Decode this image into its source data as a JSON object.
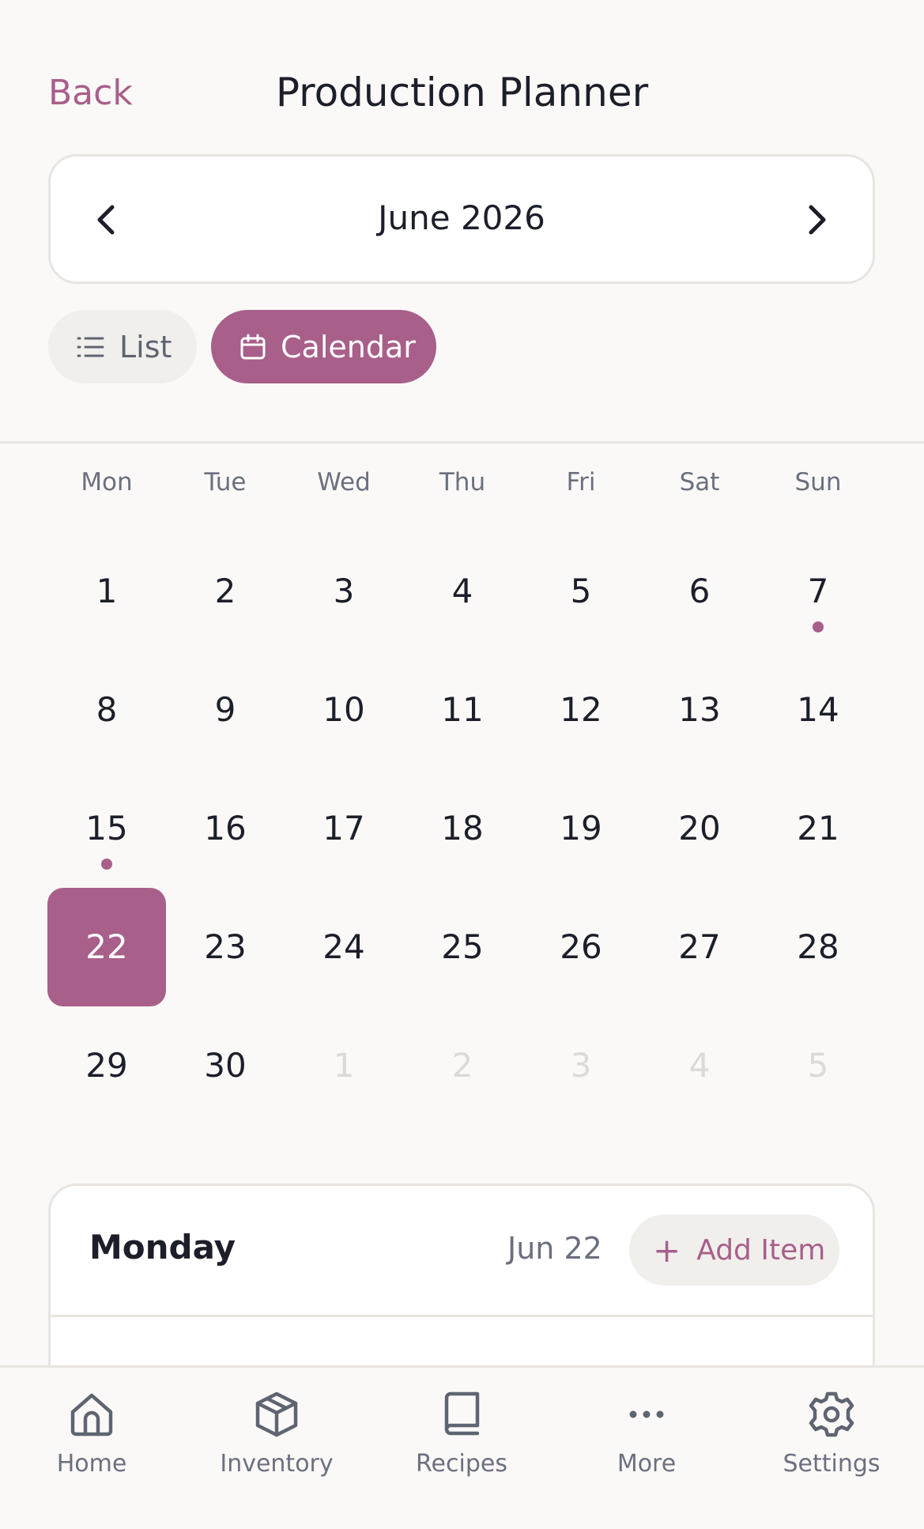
{
  "header": {
    "back_label": "Back",
    "title": "Production Planner"
  },
  "month_nav": {
    "label": "June 2026",
    "prev_icon": "chevron-left-icon",
    "next_icon": "chevron-right-icon"
  },
  "view_toggle": {
    "list_label": "List",
    "calendar_label": "Calendar",
    "selected": "Calendar"
  },
  "calendar": {
    "weekdays": [
      "Mon",
      "Tue",
      "Wed",
      "Thu",
      "Fri",
      "Sat",
      "Sun"
    ],
    "weeks": [
      [
        "1",
        "2",
        "3",
        "4",
        "5",
        "6",
        "7"
      ],
      [
        "8",
        "9",
        "10",
        "11",
        "12",
        "13",
        "14"
      ],
      [
        "15",
        "16",
        "17",
        "18",
        "19",
        "20",
        "21"
      ],
      [
        "22",
        "23",
        "24",
        "25",
        "26",
        "27",
        "28"
      ],
      [
        "29",
        "30",
        "1",
        "2",
        "3",
        "4",
        "5"
      ]
    ],
    "selected_day": "22",
    "days_with_events": [
      "7",
      "15"
    ],
    "next_month_days": [
      "1",
      "2",
      "3",
      "4",
      "5"
    ]
  },
  "day_card": {
    "weekday": "Monday",
    "date": "Jun 22",
    "add_label": "Add Item"
  },
  "tabbar": {
    "items": [
      {
        "label": "Home",
        "icon": "home-icon"
      },
      {
        "label": "Inventory",
        "icon": "box-icon"
      },
      {
        "label": "Recipes",
        "icon": "book-icon"
      },
      {
        "label": "More",
        "icon": "more-icon"
      },
      {
        "label": "Settings",
        "icon": "gear-icon"
      }
    ]
  },
  "colors": {
    "accent": "#a85f8a",
    "background": "#faf9f7",
    "text": "#1c1f2a",
    "muted": "#6b7080"
  }
}
